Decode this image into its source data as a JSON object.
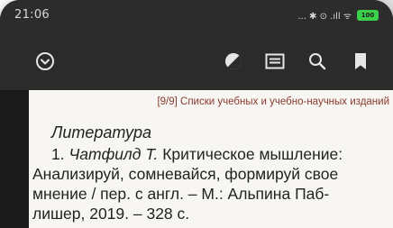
{
  "status_bar": {
    "time": "21:06",
    "indicators": "... ✱ ⊙ .ıll ᯤ",
    "battery_level": "100",
    "battery_color": "#3ad04a"
  },
  "toolbar": {
    "icons": [
      "chevron-down-circle-icon",
      "contrast-icon",
      "table-of-contents-icon",
      "search-icon",
      "bookmark-icon"
    ]
  },
  "page": {
    "header_ref": "[9/9] Списки учебных и учебно-научных изданий",
    "section_heading": "Литература",
    "entry_number": "1.",
    "entry_author": "Чатфилд Т.",
    "entry_line1_rest": "Критическое мышление:",
    "entry_line2": "Анализируй, сомневайся, формируй свое",
    "entry_line3": "мнение / пер. с англ. – М.: Альпина Паб-",
    "entry_line4": "лишер, 2019. – 328 с."
  }
}
